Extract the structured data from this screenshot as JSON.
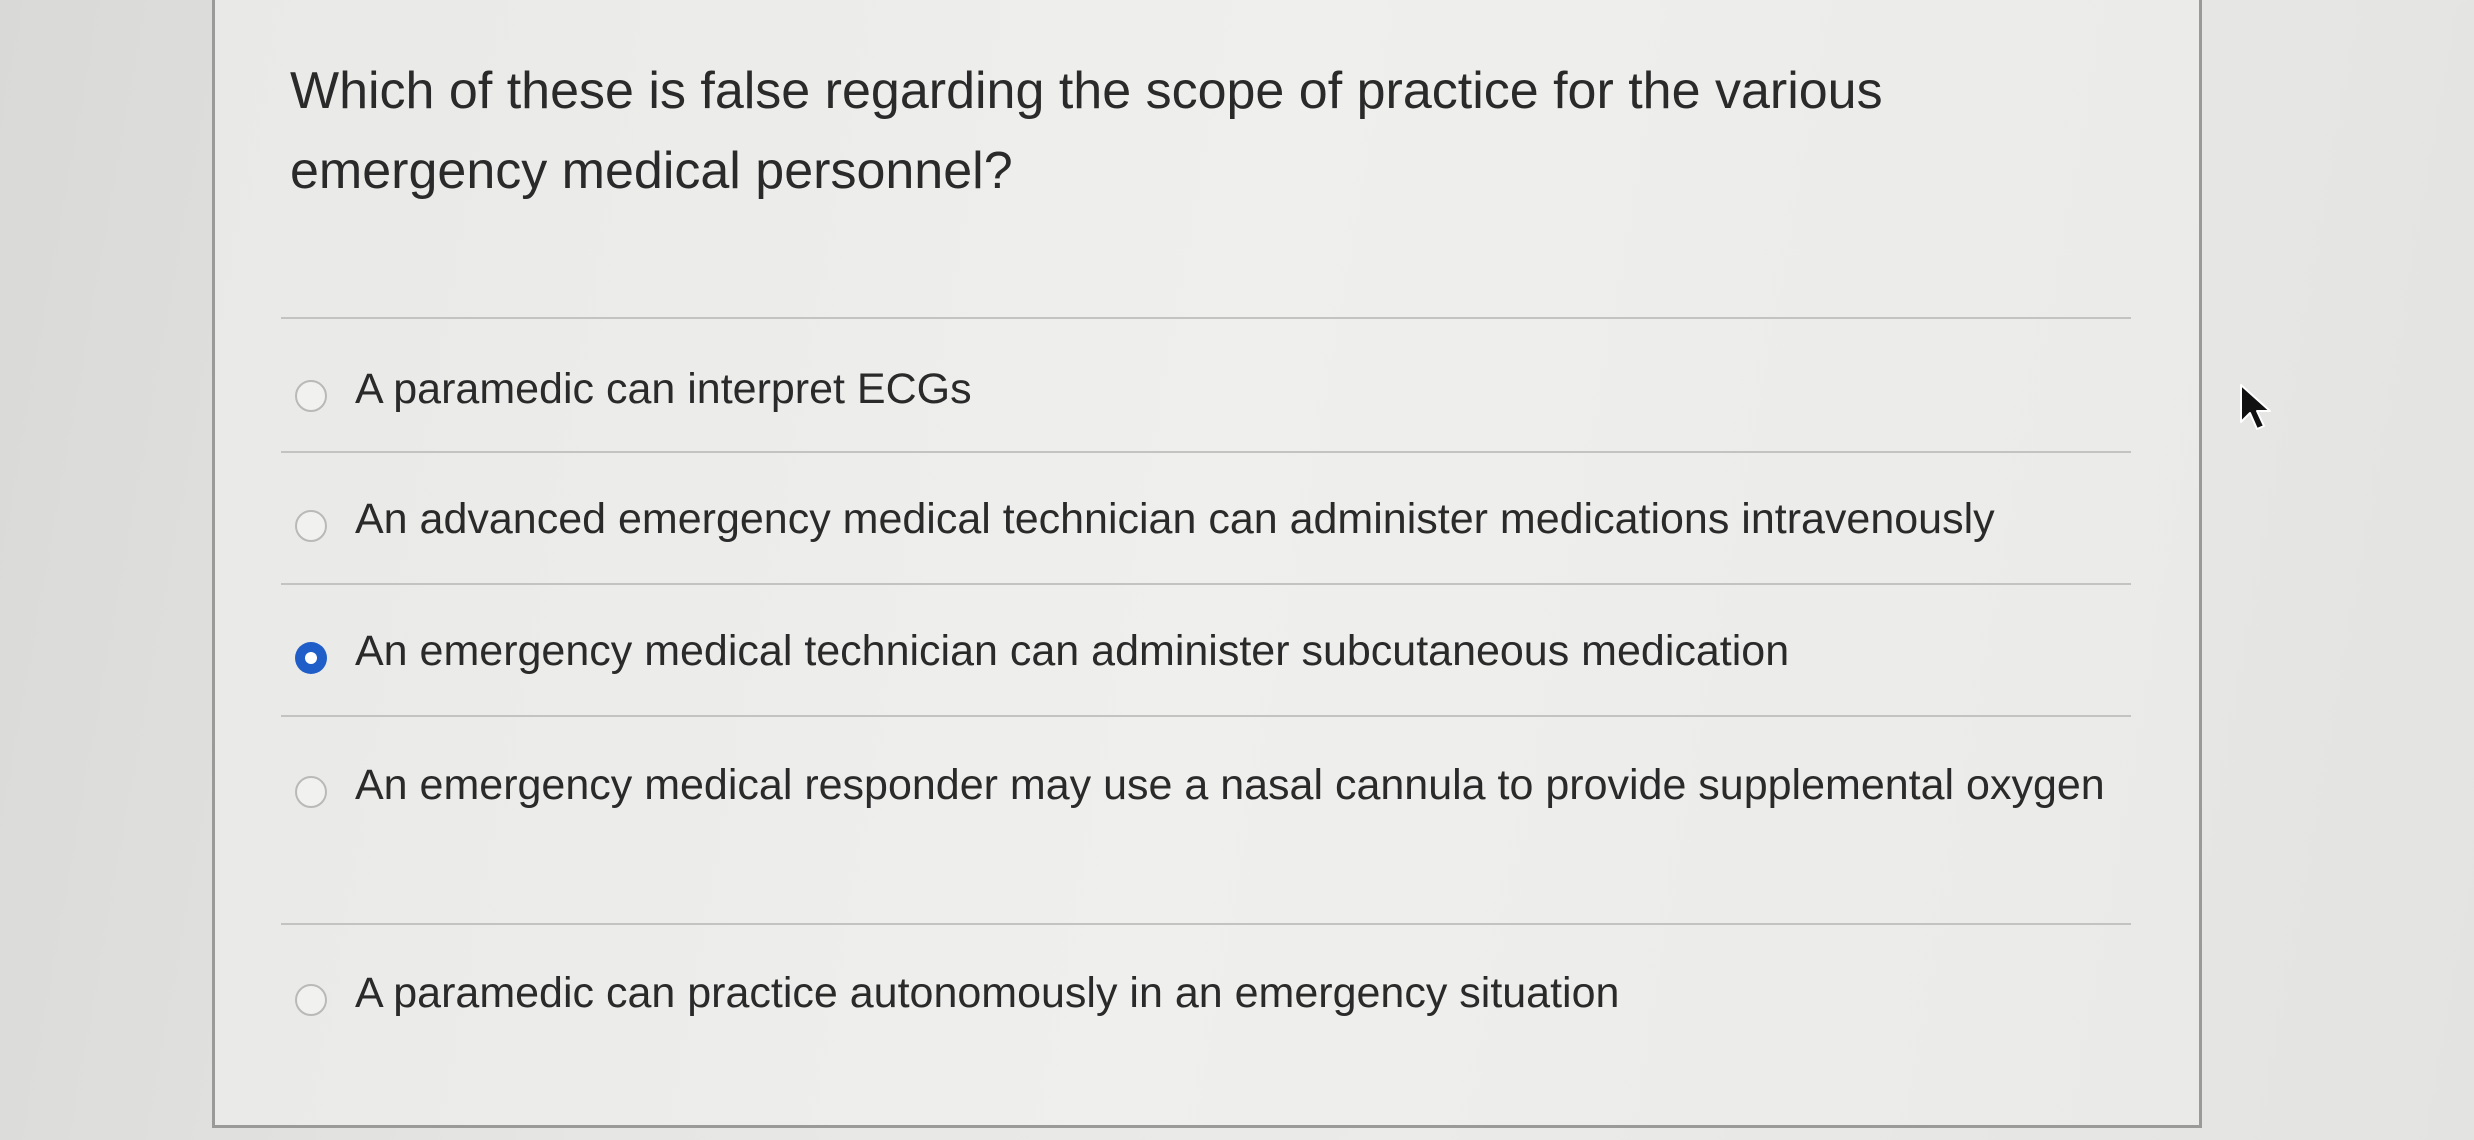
{
  "question": {
    "text": "Which of these is false regarding the scope of practice for the various emergency medical personnel?"
  },
  "options": [
    {
      "label": "A paramedic can interpret ECGs",
      "selected": false
    },
    {
      "label": "An advanced emergency medical technician can administer medications intravenously",
      "selected": false
    },
    {
      "label": "An emergency medical technician can administer subcutaneous medication",
      "selected": true
    },
    {
      "label": "An emergency medical responder may use a nasal cannula to provide supplemental oxygen",
      "selected": false
    },
    {
      "label": "A paramedic can practice autonomously in an emergency situation",
      "selected": false
    }
  ],
  "colors": {
    "selected_radio": "#1f5ec8",
    "text": "#2a2a2a",
    "divider": "#c3c3c1"
  },
  "icons": {
    "cursor": "mouse-pointer-icon"
  }
}
